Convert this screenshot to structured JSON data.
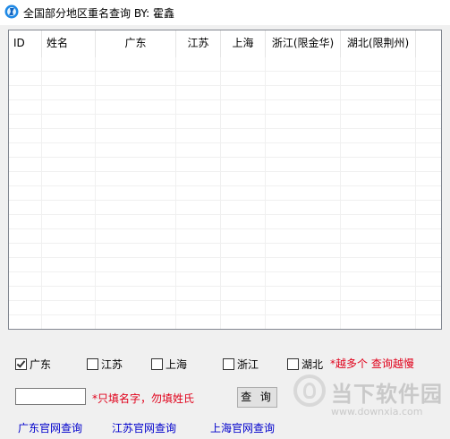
{
  "window": {
    "title": "全国部分地区重名查询    BY: 霍鑫"
  },
  "table": {
    "columns": [
      "ID",
      "姓名",
      "广东",
      "江苏",
      "上海",
      "浙江(限金华)",
      "湖北(限荆州)"
    ],
    "rows": []
  },
  "regions": [
    {
      "label": "广东",
      "checked": true
    },
    {
      "label": "江苏",
      "checked": false
    },
    {
      "label": "上海",
      "checked": false
    },
    {
      "label": "浙江",
      "checked": false
    },
    {
      "label": "湖北",
      "checked": false
    }
  ],
  "warning_text": "*越多个 查询越慢",
  "name_input": {
    "value": "",
    "placeholder": ""
  },
  "hint_text": "*只填名字，勿填姓氏",
  "query_button": "查 询",
  "links": [
    "广东官网查询",
    "江苏官网查询",
    "上海官网查询"
  ],
  "watermark": {
    "title": "当下软件园",
    "url": "www.downxia.com"
  },
  "colors": {
    "accent_red": "#e0001a",
    "link_blue": "#0000cc"
  }
}
